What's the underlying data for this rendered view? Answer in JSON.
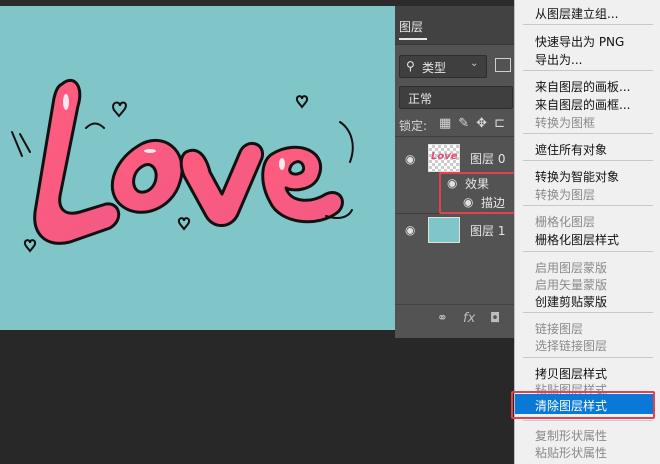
{
  "layers_panel": {
    "tab_title": "图层",
    "filter_label": "类型",
    "blend_mode": "正常",
    "lock_label": "锁定:",
    "layers": [
      {
        "name": "图层 0",
        "effects_label": "效果",
        "effect_items": [
          "描边"
        ]
      },
      {
        "name": "图层 1"
      }
    ],
    "bottom_icons": [
      "link-icon",
      "fx-icon",
      "mask-icon"
    ]
  },
  "context_menu": {
    "items": [
      {
        "label": "从图层建立组...",
        "enabled": true
      },
      {
        "label": "快速导出为 PNG",
        "enabled": true
      },
      {
        "label": "导出为...",
        "enabled": true
      },
      {
        "label": "来自图层的画板...",
        "enabled": true
      },
      {
        "label": "来自图层的画框...",
        "enabled": true
      },
      {
        "label": "转换为图框",
        "enabled": false
      },
      {
        "label": "遮住所有对象",
        "enabled": true
      },
      {
        "label": "转换为智能对象",
        "enabled": true
      },
      {
        "label": "转换为图层",
        "enabled": false
      },
      {
        "label": "栅格化图层",
        "enabled": false
      },
      {
        "label": "栅格化图层样式",
        "enabled": true
      },
      {
        "label": "启用图层蒙版",
        "enabled": false
      },
      {
        "label": "启用矢量蒙版",
        "enabled": false
      },
      {
        "label": "创建剪贴蒙版",
        "enabled": true
      },
      {
        "label": "链接图层",
        "enabled": false
      },
      {
        "label": "选择链接图层",
        "enabled": false
      },
      {
        "label": "拷贝图层样式",
        "enabled": true
      },
      {
        "label": "粘贴图层样式",
        "enabled": false
      },
      {
        "label": "清除图层样式",
        "enabled": true,
        "highlighted": true
      },
      {
        "label": "复制形状属性",
        "enabled": false
      },
      {
        "label": "粘贴形状属性",
        "enabled": false
      }
    ]
  },
  "canvas": {
    "artwork_text": "Love",
    "background_color": "#80c6c8",
    "text_color": "#f05a7e"
  }
}
